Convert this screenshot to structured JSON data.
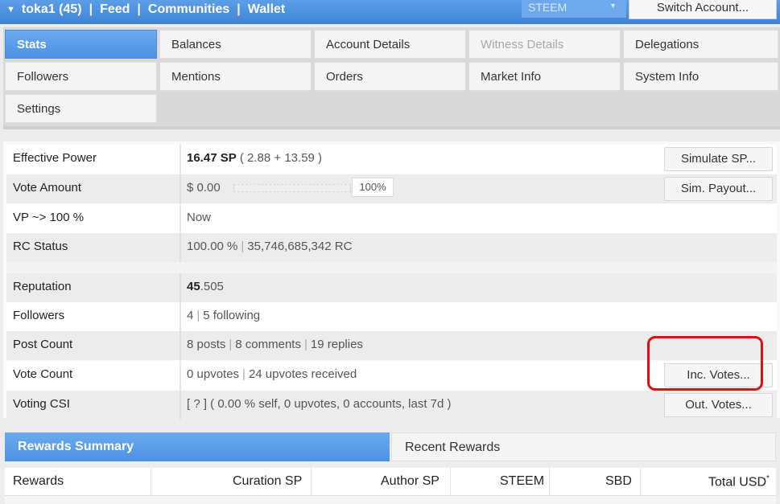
{
  "topbar": {
    "account": "toka1 (45)",
    "links": [
      "Feed",
      "Communities",
      "Wallet"
    ],
    "separator": "|",
    "chain_select": "STEEM",
    "switch_button": "Switch Account..."
  },
  "tabs": [
    {
      "label": "Stats",
      "state": "active"
    },
    {
      "label": "Balances",
      "state": "normal"
    },
    {
      "label": "Account Details",
      "state": "normal"
    },
    {
      "label": "Witness Details",
      "state": "disabled"
    },
    {
      "label": "Delegations",
      "state": "normal"
    },
    {
      "label": "Followers",
      "state": "normal"
    },
    {
      "label": "Mentions",
      "state": "normal"
    },
    {
      "label": "Orders",
      "state": "normal"
    },
    {
      "label": "Market Info",
      "state": "normal"
    },
    {
      "label": "System Info",
      "state": "normal"
    },
    {
      "label": "Settings",
      "state": "normal"
    }
  ],
  "stats": {
    "effective_power": {
      "label": "Effective Power",
      "value_bold": "16.47 SP",
      "value_rest": " ( 2.88 + 13.59 )",
      "button": "Simulate SP..."
    },
    "vote_amount": {
      "label": "Vote Amount",
      "value": "$ 0.00",
      "percent": "100%",
      "slider_level": 1.0,
      "button": "Sim. Payout..."
    },
    "vp": {
      "label": "VP ~> 100 %",
      "value": "Now"
    },
    "rc_status": {
      "label": "RC Status",
      "value_a": "100.00 %",
      "value_b": "35,746,685,342 RC"
    },
    "reputation": {
      "label": "Reputation",
      "value_bold": "45",
      "value_rest": ".505"
    },
    "followers": {
      "label": "Followers",
      "value_a": "4",
      "value_b": "5 following"
    },
    "post_count": {
      "label": "Post Count",
      "value_a": "8 posts",
      "value_b": "8 comments",
      "value_c": "19 replies"
    },
    "vote_count": {
      "label": "Vote Count",
      "value_a": "0 upvotes",
      "value_b": "24 upvotes received",
      "button": "Inc. Votes..."
    },
    "voting_csi": {
      "label": "Voting CSI",
      "value": "[ ? ] ( 0.00 % self, 0 upvotes, 0 accounts, last 7d )",
      "button": "Out. Votes..."
    },
    "pipe": "|"
  },
  "rewards": {
    "tabs": [
      "Rewards Summary",
      "Recent Rewards"
    ],
    "columns": [
      "Rewards",
      "Curation SP",
      "Author SP",
      "STEEM",
      "SBD",
      "Total USD"
    ],
    "total_usd_mark": "*"
  },
  "colors": {
    "accent_blue": "#4c91e2",
    "highlight_red": "#e01010"
  }
}
